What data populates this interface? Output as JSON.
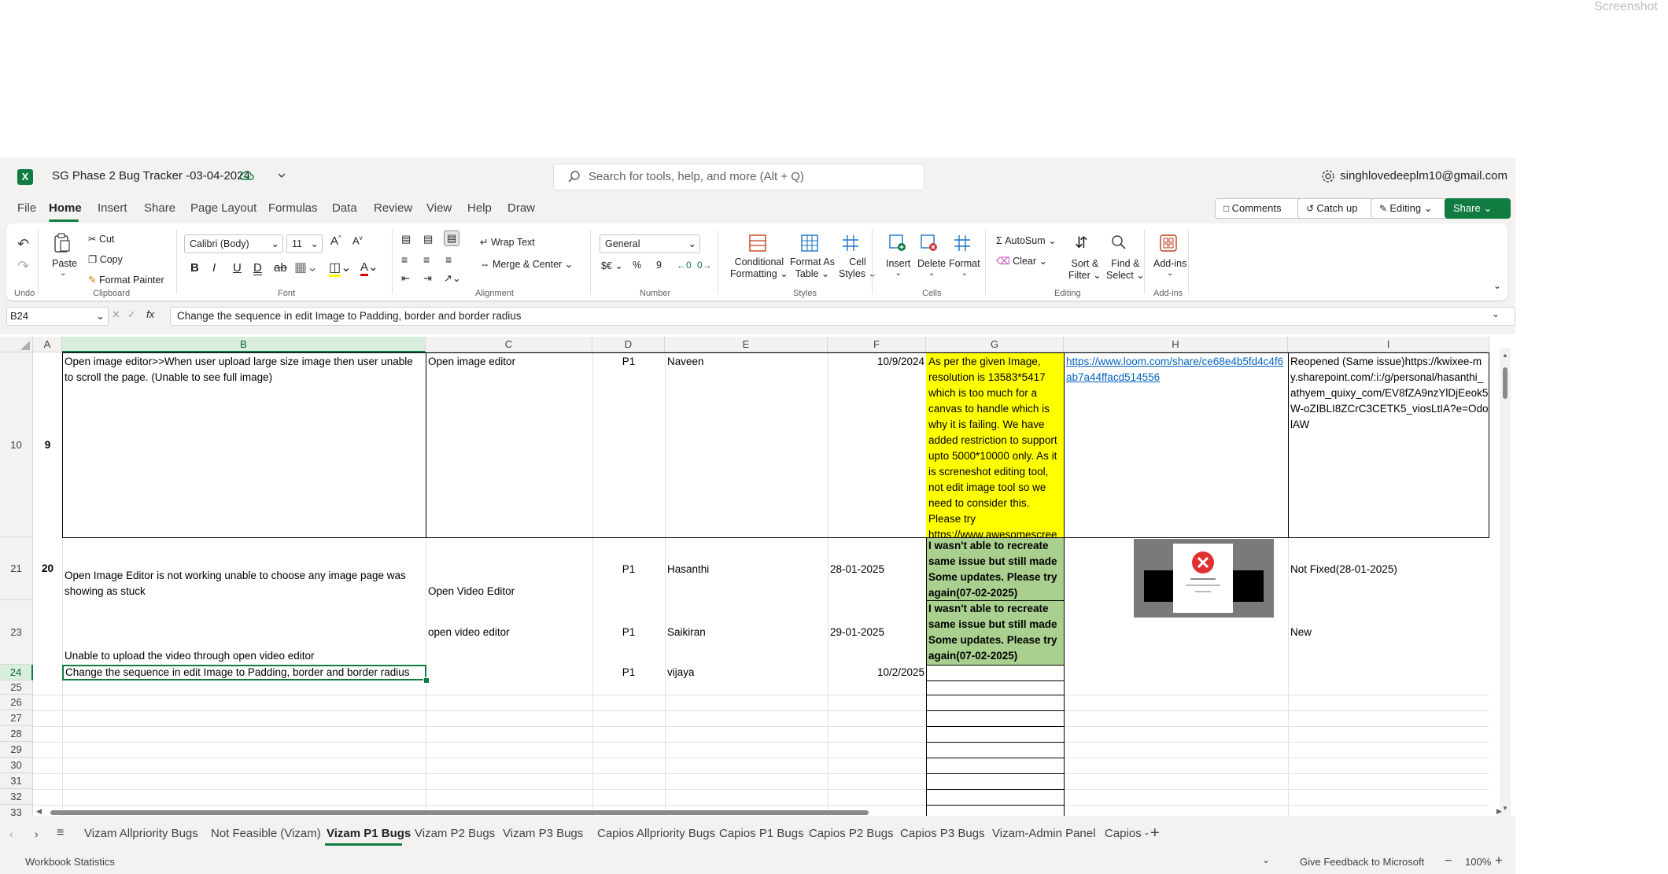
{
  "corner_label": "Screenshot",
  "app": {
    "logo": "X",
    "doc_title": "SG Phase 2 Bug Tracker -03-04-2024",
    "search_placeholder": "Search for tools, help, and more (Alt + Q)",
    "user_email": "singhlovedeeplm10@gmail.com"
  },
  "menu": {
    "items": [
      "File",
      "Home",
      "Insert",
      "Share",
      "Page Layout",
      "Formulas",
      "Data",
      "Review",
      "View",
      "Help",
      "Draw"
    ],
    "comments": "Comments",
    "catch_up": "Catch up",
    "editing": "Editing",
    "share": "Share"
  },
  "ribbon": {
    "undo_group": "Undo",
    "paste": "Paste",
    "cut": "Cut",
    "copy": "Copy",
    "format_painter": "Format Painter",
    "clipboard_group": "Clipboard",
    "font_name": "Calibri (Body)",
    "font_size": "11",
    "font_group": "Font",
    "wrap_text": "Wrap Text",
    "merge_center": "Merge & Center",
    "alignment_group": "Alignment",
    "number_format": "General",
    "number_group": "Number",
    "currency": "$€",
    "percent": "%",
    "comma": "9",
    "conditional_formatting_1": "Conditional",
    "conditional_formatting_2": "Formatting",
    "format_as_table_1": "Format As",
    "format_as_table_2": "Table",
    "cell_styles_1": "Cell",
    "cell_styles_2": "Styles",
    "styles_group": "Styles",
    "insert": "Insert",
    "delete": "Delete",
    "format": "Format",
    "cells_group": "Cells",
    "autosum": "AutoSum",
    "clear": "Clear",
    "sort_filter_1": "Sort &",
    "sort_filter_2": "Filter",
    "find_select_1": "Find &",
    "find_select_2": "Select",
    "editing_group": "Editing",
    "addins": "Add-ins",
    "addins_group": "Add-ins"
  },
  "formula_bar": {
    "name_box": "B24",
    "fx": "fx",
    "content": "Change the sequence in edit Image to Padding, border and border radius"
  },
  "columns": [
    "A",
    "B",
    "C",
    "D",
    "E",
    "F",
    "G",
    "H",
    "I"
  ],
  "rows": {
    "r10": {
      "num": "10",
      "a": "9",
      "b": "Open image editor>>When user upload large size image then user unable to scroll the page. (Unable to see full image)",
      "c": "Open image editor",
      "d": "P1",
      "e": "Naveen",
      "f": "10/9/2024",
      "g": "As per the given Image, resolution is 13583*5417 which is too much for a canvas to handle which is why it is failing. We have added restriction to support upto 5000*10000 only. As it is screneshot editing tool, not edit image tool so we need to consider this. Please try https://www.awesomescree",
      "h": "https://www.loom.com/share/ce68e4b5fd4c4f6ab7a44ffacd514556",
      "i": "Reopened (Same issue)https://kwixee-my.sharepoint.com/:i:/g/personal/hasanthi_athyem_quixy_com/EV8fZA9nzYlDjEeok5W-oZIBLI8ZCrC3CETK5_viosLtIA?e=OdolAW"
    },
    "r21": {
      "num": "21",
      "a": "20",
      "b": "Open Image Editor is not working unable to choose any image page was showing as stuck",
      "c": "Open Video Editor",
      "d": "P1",
      "e": "Hasanthi",
      "f": "28-01-2025",
      "g": "I wasn't able to recreate same issue but still made Some updates. Please try again(07-02-2025)",
      "i": "Not Fixed(28-01-2025)"
    },
    "r23": {
      "num": "23",
      "b": "Unable to upload the video through open video editor",
      "c": "open video editor",
      "d": "P1",
      "e": "Saikiran",
      "f": "29-01-2025",
      "g": "I wasn't able to recreate same issue but still made Some updates. Please try again(07-02-2025)",
      "i": "New"
    },
    "r24": {
      "num": "24",
      "b": "Change the sequence in edit Image to Padding, border and border radius",
      "d": "P1",
      "e": "vijaya",
      "f": "10/2/2025"
    },
    "empty_rows": [
      "25",
      "26",
      "27",
      "28",
      "29",
      "30",
      "31",
      "32",
      "33"
    ]
  },
  "sheet_tabs": [
    "Vizam Allpriority Bugs",
    "Not Feasible (Vizam)",
    "Vizam P1 Bugs",
    "Vizam P2 Bugs",
    "Vizam P3 Bugs",
    "Capios Allpriority Bugs",
    "Capios P1 Bugs",
    "Capios P2 Bugs",
    "Capios P3 Bugs",
    "Vizam-Admin Panel",
    "Capios -"
  ],
  "status": {
    "workbook_statistics": "Workbook Statistics",
    "feedback": "Give Feedback to Microsoft",
    "zoom": "100%"
  },
  "colors": {
    "accent": "#107c41",
    "yellow_fill": "#ffff00",
    "green_fill": "#a9d08e",
    "link": "#0563c1"
  }
}
